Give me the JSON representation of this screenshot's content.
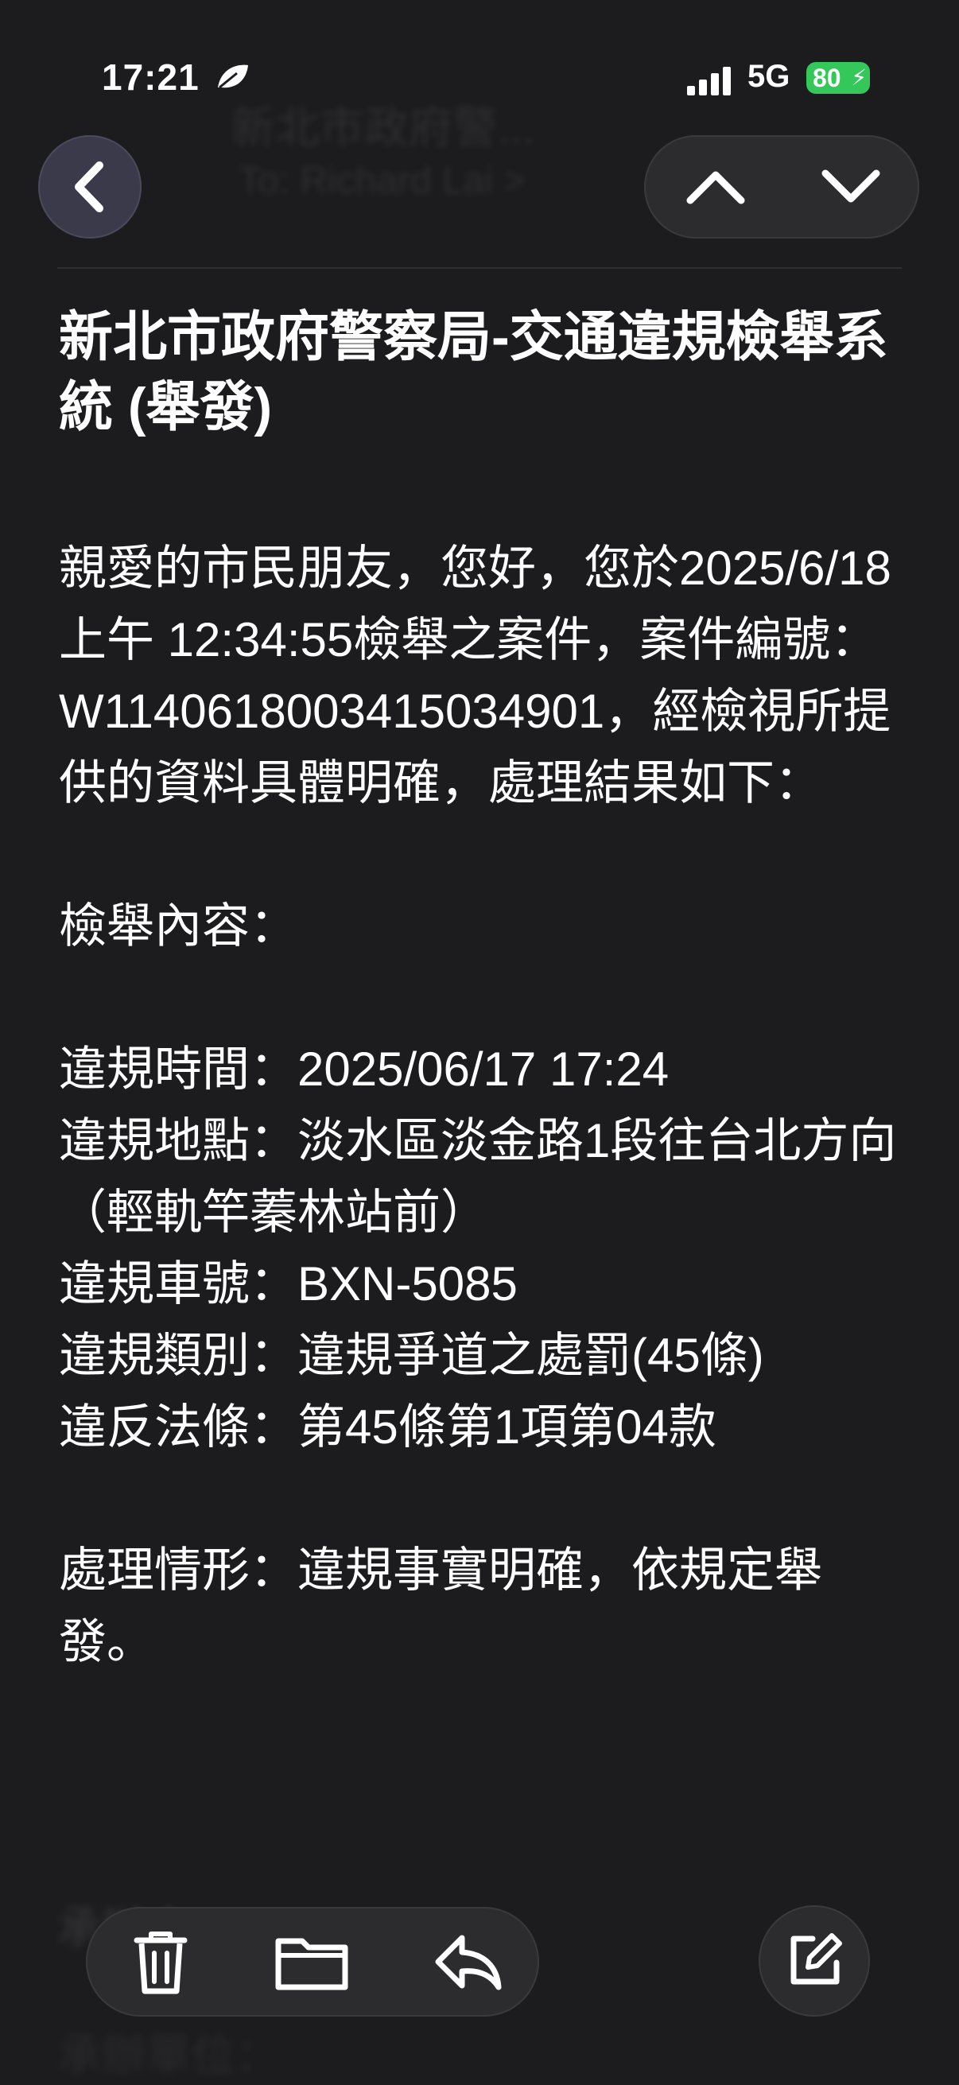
{
  "status_bar": {
    "time": "17:21",
    "network": "5G",
    "battery": "80",
    "signal_icon": "cellular-signal-icon",
    "focus_icon": "leaf-icon",
    "accent_battery": "#34c759"
  },
  "header": {
    "sender_blurred": "新北市政府警...",
    "recipient_blurred": "To: Richard Lai >"
  },
  "subject": "新北市政府警察局-交通違規檢舉系統 (舉發)",
  "body": {
    "intro": "親愛的市民朋友，您好，您於2025/6/18 上午 12:34:55檢舉之案件，案件編號：W11406180034150349​01，經檢視所提供的資料具體明確，處理結果如下：",
    "content_heading": "檢舉內容：",
    "violation_time": "違規時間：2025/06/17 17:24",
    "violation_location": "違規地點：淡水區淡金路1段往台北方向（輕軌竿蓁林站前）",
    "plate_number": "違規車號：BXN-5085",
    "violation_type": "違規類別：違規爭道之處罰(45條)",
    "law_article": "違反法條：第45條第1項第04款",
    "handling": "處理情形：違規事實明確，依規定舉發。"
  },
  "footer_blurred": {
    "line1": "承辦人：",
    "line2": "承辦單位："
  },
  "toolbar": {
    "delete_icon": "trash-icon",
    "move_icon": "folder-icon",
    "reply_icon": "reply-icon",
    "compose_icon": "compose-icon"
  }
}
